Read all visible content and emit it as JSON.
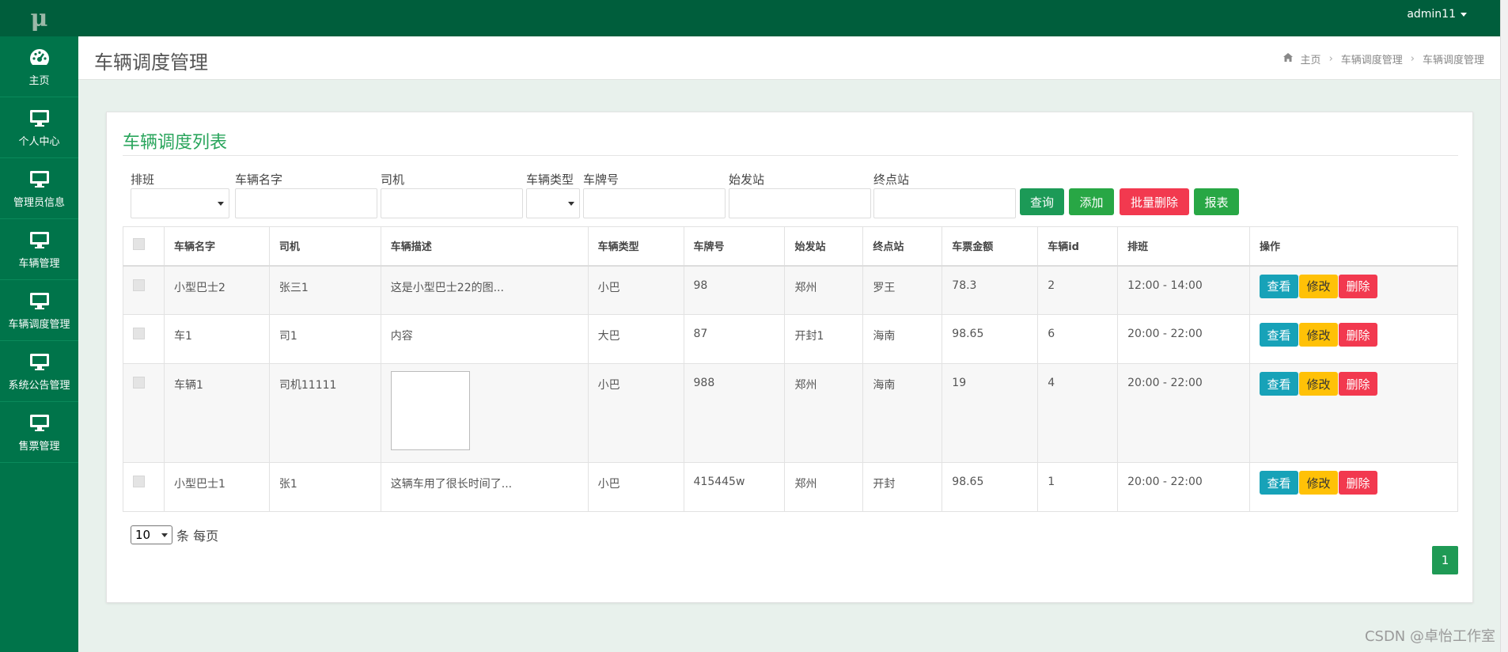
{
  "app": {
    "logo": "μ",
    "user": "admin11"
  },
  "sidebar": {
    "items": [
      {
        "label": "主页",
        "icon": "dashboard-icon"
      },
      {
        "label": "个人中心",
        "icon": "monitor-icon"
      },
      {
        "label": "管理员信息",
        "icon": "monitor-icon"
      },
      {
        "label": "车辆管理",
        "icon": "monitor-icon"
      },
      {
        "label": "车辆调度管理",
        "icon": "monitor-icon"
      },
      {
        "label": "系统公告管理",
        "icon": "monitor-icon"
      },
      {
        "label": "售票管理",
        "icon": "monitor-icon"
      }
    ]
  },
  "header": {
    "title": "车辆调度管理",
    "breadcrumb": [
      "主页",
      "车辆调度管理",
      "车辆调度管理"
    ]
  },
  "panel": {
    "title": "车辆调度列表"
  },
  "filters": {
    "schedule": "排班",
    "vehicle_name": "车辆名字",
    "driver": "司机",
    "vehicle_type": "车辆类型",
    "plate": "车牌号",
    "origin": "始发站",
    "terminal": "终点站"
  },
  "buttons": {
    "query": "查询",
    "add": "添加",
    "batch_delete": "批量删除",
    "report": "报表"
  },
  "table": {
    "headers": [
      "车辆名字",
      "司机",
      "车辆描述",
      "车辆类型",
      "车牌号",
      "始发站",
      "终点站",
      "车票金额",
      "车辆id",
      "排班",
      "操作"
    ],
    "rows": [
      {
        "name": "小型巴士2",
        "driver": "张三1",
        "desc": "这是小型巴士22的图...",
        "type": "小巴",
        "plate": "98",
        "origin": "郑州",
        "terminal": "罗王",
        "price": "78.3",
        "id": "2",
        "schedule": "12:00 - 14:00"
      },
      {
        "name": "车1",
        "driver": "司1",
        "desc": "内容",
        "type": "大巴",
        "plate": "87",
        "origin": "开封1",
        "terminal": "海南",
        "price": "98.65",
        "id": "6",
        "schedule": "20:00 - 22:00"
      },
      {
        "name": "车辆1",
        "driver": "司机11111",
        "desc": "",
        "type": "小巴",
        "plate": "988",
        "origin": "郑州",
        "terminal": "海南",
        "price": "19",
        "id": "4",
        "schedule": "20:00 - 22:00"
      },
      {
        "name": "小型巴士1",
        "driver": "张1",
        "desc": "这辆车用了很长时间了...",
        "type": "小巴",
        "plate": "415445w",
        "origin": "郑州",
        "terminal": "开封",
        "price": "98.65",
        "id": "1",
        "schedule": "20:00 - 22:00"
      }
    ],
    "actions": {
      "view": "查看",
      "edit": "修改",
      "delete": "删除"
    }
  },
  "pager": {
    "page_size": "10",
    "per_page_label": "条 每页",
    "current_page": "1"
  },
  "watermark": "CSDN @卓怡工作室",
  "colors": {
    "topbar": "#005e3c",
    "sidebar": "#00744a",
    "accent": "#2aa55c",
    "query": "#1c9a57",
    "add": "#28a745",
    "danger": "#f2394f",
    "info": "#17a2b8",
    "warning": "#ffc107"
  }
}
